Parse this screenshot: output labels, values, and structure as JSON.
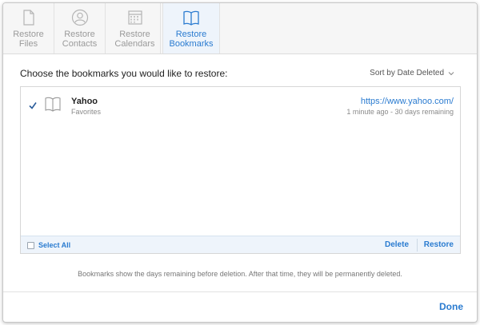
{
  "tabs": [
    {
      "line1": "Restore",
      "line2": "Files",
      "icon": "file-icon"
    },
    {
      "line1": "Restore",
      "line2": "Contacts",
      "icon": "contact-icon"
    },
    {
      "line1": "Restore",
      "line2": "Calendars",
      "icon": "calendar-icon"
    },
    {
      "line1": "Restore",
      "line2": "Bookmarks",
      "icon": "book-icon",
      "active": true
    }
  ],
  "main": {
    "prompt": "Choose the bookmarks you would like to restore:",
    "sort_label": "Sort by Date Deleted"
  },
  "bookmarks": [
    {
      "title": "Yahoo",
      "folder": "Favorites",
      "url": "https://www.yahoo.com/",
      "meta": "1 minute ago - 30 days remaining",
      "checked": true
    }
  ],
  "list_footer": {
    "select_all": "Select All",
    "delete": "Delete",
    "restore": "Restore"
  },
  "note": "Bookmarks show the days remaining before deletion. After that time, they will be permanently deleted.",
  "done": "Done",
  "colors": {
    "accent": "#2a7bd0",
    "muted": "#9a9a9a",
    "footer_bg": "#eef4fb"
  }
}
